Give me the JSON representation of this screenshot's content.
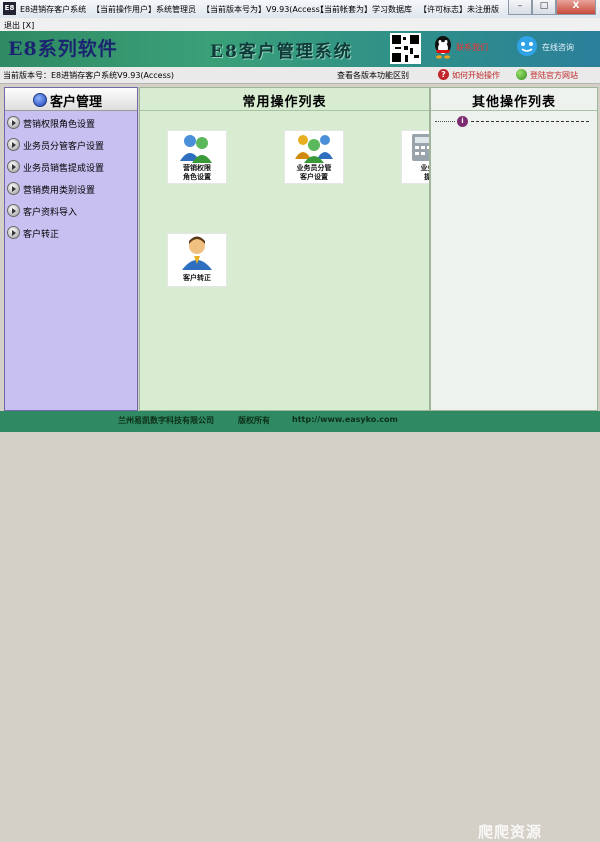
{
  "window": {
    "title_segments": [
      "E8进销存客户系统",
      "【当前操作用户】系统管理员",
      "【当前版本号为】V9.93(Access)",
      "【当前帐套为】学习数据库",
      "【许可标志】未注册版"
    ],
    "min_label": "–",
    "max_label": "□",
    "close_label": "X"
  },
  "menubar": {
    "exit_label": "退出 [X]"
  },
  "banner": {
    "brand": "E8系列软件",
    "system_title": "E8客户管理系统",
    "qq_link_1": "联系我们",
    "qq_link_2": "在线咨询"
  },
  "statusbar": {
    "version": "当前版本号：E8进销存客户系统V9.93(Access)",
    "compare": "查看各版本功能区别",
    "how_to": "如何开始操作",
    "official": "登陆官方网站"
  },
  "sidebar": {
    "title": "客户管理",
    "items": [
      {
        "label": "营销权限角色设置"
      },
      {
        "label": "业务员分管客户设置"
      },
      {
        "label": "业务员销售提成设置"
      },
      {
        "label": "营销费用类别设置"
      },
      {
        "label": "客户资料导入"
      },
      {
        "label": "客户转正"
      }
    ]
  },
  "main": {
    "title": "常用操作列表",
    "tiles": [
      {
        "line1": "营销权限",
        "line2": "角色设置"
      },
      {
        "line1": "业务员分管",
        "line2": "客户设置"
      },
      {
        "line1": "业务员",
        "line2": "提成"
      },
      {
        "line1": "客户转正",
        "line2": ""
      }
    ]
  },
  "other": {
    "title": "其他操作列表",
    "item_icon": "i"
  },
  "footer": {
    "company": "兰州易凯数字科技有限公司",
    "rights": "版权所有",
    "url": "http://www.easyko.com",
    "watermark": "爬爬资源"
  },
  "colors": {
    "banner": "#2f8a63",
    "sidebar": "#c9c0f2",
    "main": "#d8ecd2"
  }
}
